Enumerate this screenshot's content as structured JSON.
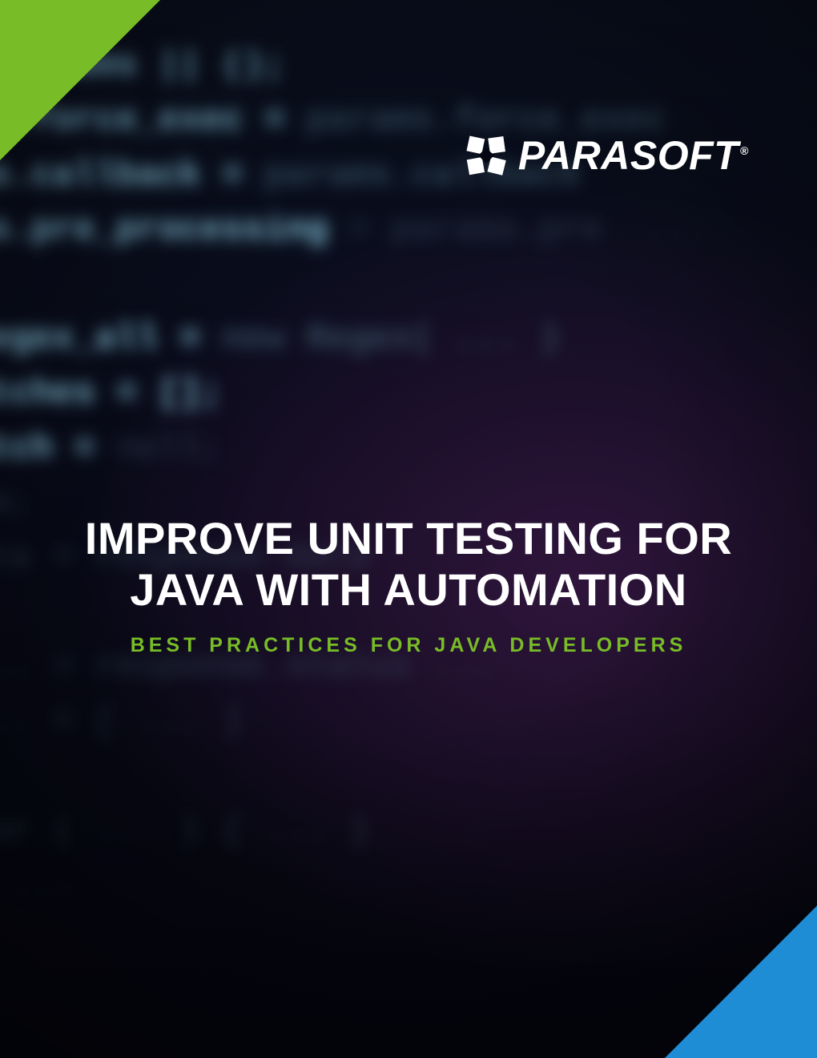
{
  "brand": {
    "name": "PARASOFT",
    "registered_mark": "®"
  },
  "title": {
    "line1": "IMPROVE UNIT TESTING FOR",
    "line2": "JAVA WITH AUTOMATION"
  },
  "subtitle": "BEST PRACTICES FOR JAVA DEVELOPERS",
  "colors": {
    "accent_green": "#78bc27",
    "accent_blue": "#1f8dd6",
    "background": "#050812",
    "text_white": "#ffffff"
  },
  "background_code_sample": "= params || ();\n s.force_exec = param ...\nms.callback = param ...\nns.pre_processing = ...\n\nregex_all = new ...\natches = [];\natch = ...\nlm;\nata = ..."
}
